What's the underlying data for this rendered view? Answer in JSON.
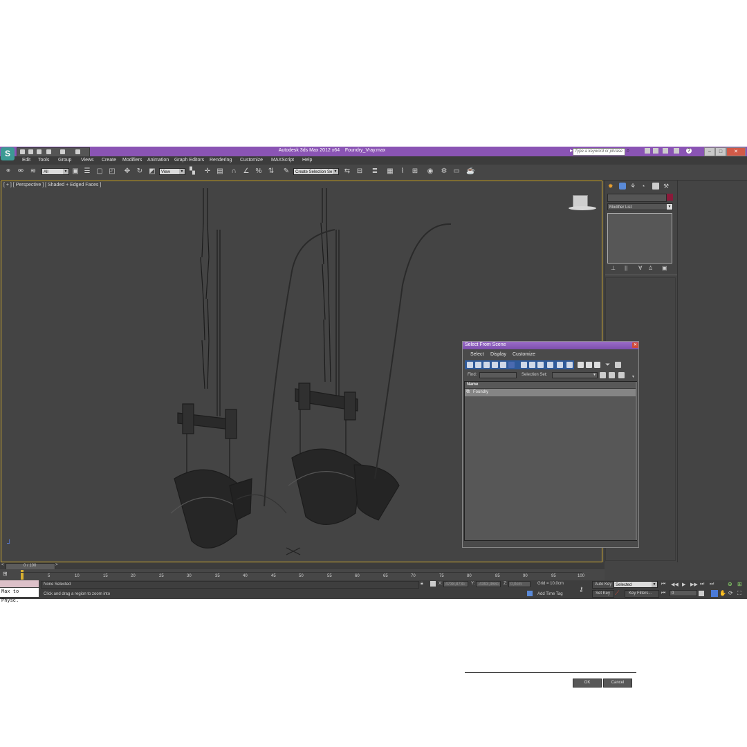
{
  "title_bar": {
    "app_title": "Autodesk 3ds Max  2012 x64",
    "file_name": "Foundry_Vray.max",
    "search_placeholder": "Type a keyword or phrase",
    "app_logo": "S"
  },
  "menu": [
    "Edit",
    "Tools",
    "Group",
    "Views",
    "Create",
    "Modifiers",
    "Animation",
    "Graph Editors",
    "Rendering",
    "Customize",
    "MAXScript",
    "Help"
  ],
  "toolbar": {
    "filter_value": "All",
    "coord_value": "View",
    "selection_set_value": "Create Selection Se"
  },
  "viewport": {
    "label": "[ + ] [ Perspective ] [ Shaded + Edged Faces ]"
  },
  "command_panel": {
    "modifier_list": "Modifier List",
    "name_color": "#8a1a3a"
  },
  "dialog": {
    "title": "Select From Scene",
    "menu": [
      "Select",
      "Display",
      "Customize"
    ],
    "find_label": "Find:",
    "selection_set_label": "Selection Set:",
    "column_header": "Name",
    "items": [
      "Foundry"
    ],
    "ok_label": "OK",
    "cancel_label": "Cancel"
  },
  "timeline": {
    "frame_counter": "0 / 100",
    "ticks": [
      "5",
      "10",
      "15",
      "20",
      "25",
      "30",
      "35",
      "40",
      "45",
      "50",
      "55",
      "60",
      "65",
      "70",
      "75",
      "80",
      "85",
      "90",
      "95",
      "100"
    ]
  },
  "status": {
    "script_label": "Max to Physc.",
    "selection_info": "None Selected",
    "prompt": "Click and drag a region to zoom into",
    "x_label": "X:",
    "x_value": "4738,873c",
    "y_label": "Y:",
    "y_value": "-4393,368c",
    "z_label": "Z:",
    "z_value": "0,0cm",
    "grid": "Grid = 10,0cm",
    "add_time_tag": "Add Time Tag",
    "auto_key": "Auto Key",
    "set_key": "Set Key",
    "key_mode_value": "Selected",
    "key_filters": "Key Filters...",
    "current_frame": "0"
  }
}
